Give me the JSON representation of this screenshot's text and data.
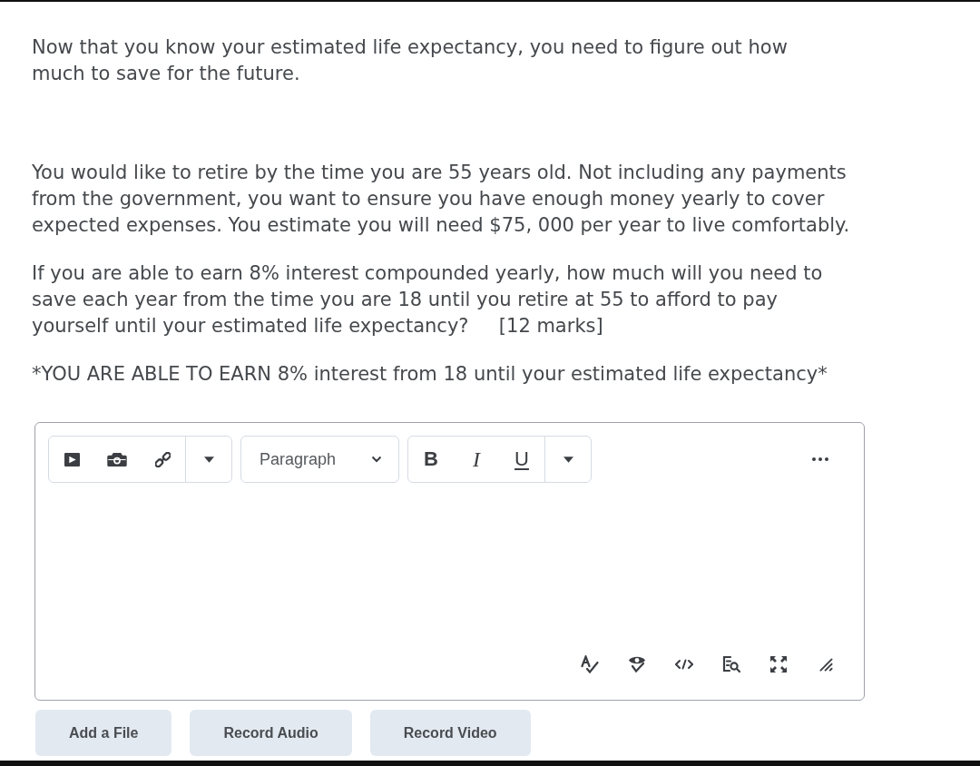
{
  "paragraphs": [
    {
      "text": "Now that you know your estimated life expectancy, you need to figure out how much to save for the future."
    },
    {
      "text": "You would like to retire by the time you are 55 years old. Not including any payments from the government, you want to ensure you have enough money yearly to cover expected expenses. You estimate you will need $75, 000 per year to live comfortably."
    },
    {
      "text": "If you are able to earn 8% interest compounded yearly, how much will you need to save each year from the time you are 18 until you retire at 55 to afford to pay yourself until your estimated life expectancy?     [12 marks]"
    },
    {
      "text": "*YOU ARE ABLE TO EARN 8% interest from 18 until your estimated life expectancy*"
    }
  ],
  "editor": {
    "block_format": "Paragraph",
    "format_buttons": [
      {
        "label": "B",
        "kind": "bold"
      },
      {
        "label": "I",
        "kind": "italic"
      },
      {
        "label": "U",
        "kind": "underline"
      }
    ]
  },
  "buttons": [
    "Add a File",
    "Record Audio",
    "Record Video"
  ]
}
